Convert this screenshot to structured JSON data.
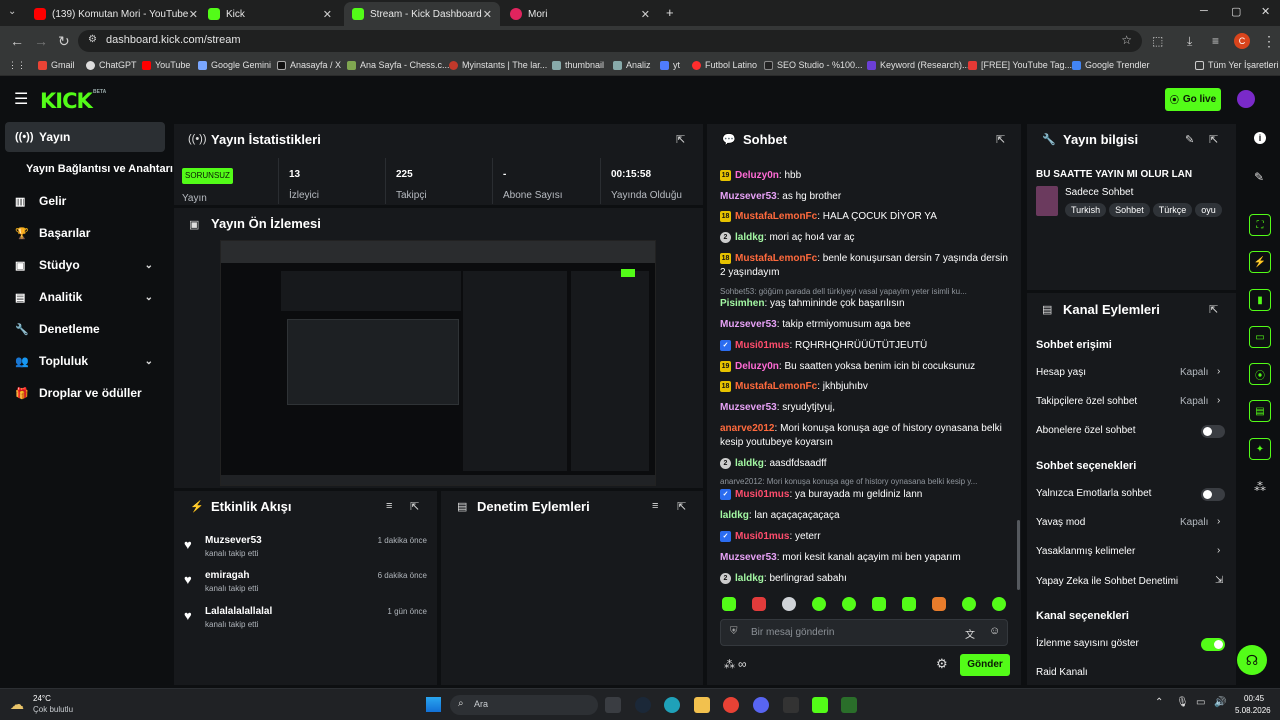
{
  "browser": {
    "tabs": [
      {
        "label": "(139) Komutan Mori - YouTube",
        "color": "#ff0000"
      },
      {
        "label": "Kick",
        "color": "#53fc18"
      },
      {
        "label": "Stream - Kick Dashboard",
        "color": "#53fc18"
      },
      {
        "label": "Mori",
        "color": "#e0245e"
      }
    ],
    "url": "dashboard.kick.com/stream",
    "profile_initial": "C",
    "bookmarks": [
      "Gmail",
      "ChatGPT",
      "YouTube",
      "Google Gemini",
      "Anasayfa / X",
      "Ana Sayfa - Chess.c...",
      "Myinstants | The lar...",
      "thumbnail",
      "Analiz",
      "yt",
      "Futbol Latino",
      "SEO Studio - %100...",
      "Keyword (Research)...",
      "[FREE] YouTube Tag...",
      "Google Trendler",
      "Tüm Yer İşaretleri"
    ]
  },
  "header": {
    "logo": "KICK",
    "logo_badge": "BETA",
    "go_live": "Go live"
  },
  "sidebar": {
    "items": [
      {
        "label": "Yayın",
        "icon": "broadcast-icon"
      },
      {
        "label": "Yayın Bağlantısı ve Anahtarı",
        "icon": ""
      },
      {
        "label": "Gelir",
        "icon": "chart-icon"
      },
      {
        "label": "Başarılar",
        "icon": "trophy-icon"
      },
      {
        "label": "Stüdyo",
        "icon": "studio-icon"
      },
      {
        "label": "Analitik",
        "icon": "analytics-icon"
      },
      {
        "label": "Denetleme",
        "icon": "wrench-icon"
      },
      {
        "label": "Topluluk",
        "icon": "community-icon"
      },
      {
        "label": "Droplar ve ödüller",
        "icon": "gift-icon"
      }
    ]
  },
  "stats": {
    "title": "Yayın İstatistikleri",
    "status_badge": "SORUNSUZ",
    "status_label": "Yayın",
    "items": [
      {
        "value": "13",
        "label": "İzleyici"
      },
      {
        "value": "225",
        "label": "Takipçi"
      },
      {
        "value": "-",
        "label": "Abone Sayısı"
      },
      {
        "value": "00:15:58",
        "label": "Yayında Olduğu"
      }
    ]
  },
  "preview": {
    "title": "Yayın Ön İzlemesi"
  },
  "activity": {
    "title": "Etkinlik Akışı",
    "events": [
      {
        "user": "Muzsever53",
        "action": "kanalı takip etti",
        "time": "1 dakika önce"
      },
      {
        "user": "emiragah",
        "action": "kanalı takip etti",
        "time": "6 dakika önce"
      },
      {
        "user": "Lalalalalallalal",
        "action": "kanalı takip etti",
        "time": "1 gün önce"
      }
    ]
  },
  "moderation": {
    "title": "Denetim Eylemleri"
  },
  "chat": {
    "title": "Sohbet",
    "messages": [
      {
        "user": "Deluzy0n",
        "text": "hbb",
        "color": "u-pink",
        "badge": "19",
        "badge_type": "b-sub"
      },
      {
        "user": "Muzsever53",
        "text": "as hg brother",
        "color": "u-purple",
        "badge": "",
        "badge_type": ""
      },
      {
        "user": "MustafaLemonFc",
        "text": "HALA ÇOCUK DİYOR YA",
        "color": "u-orange",
        "badge": "18",
        "badge_type": "b-sub"
      },
      {
        "user": "laldkg",
        "text": "mori aç hoı4 var aç",
        "color": "u-green",
        "badge": "2",
        "badge_type": "b-n"
      },
      {
        "user": "MustafaLemonFc",
        "text": "benle konuşursan dersin 7 yaşında dersin 2 yaşındayım",
        "color": "u-orange",
        "badge": "18",
        "badge_type": "b-sub"
      },
      {
        "user": "Pisimhen",
        "text": "yaş tahmininde çok başarılısın",
        "color": "u-green",
        "badge": "",
        "badge_type": "",
        "reply": "Sohbet53: göğüm parada dell türkiyeyi vasal yapayim yeter isimli ku..."
      },
      {
        "user": "Muzsever53",
        "text": "takip etrmiyomusum aga bee",
        "color": "u-purple",
        "badge": "",
        "badge_type": ""
      },
      {
        "user": "Musi01mus",
        "text": "RQHRHQHRÜÜÜTÜTJEUTÜ",
        "color": "u-blue",
        "badge": "",
        "badge_type": "b-v"
      },
      {
        "user": "Deluzy0n",
        "text": "Bu saatten yoksa benim icin bi cocuksunuz",
        "color": "u-pink",
        "badge": "19",
        "badge_type": "b-sub"
      },
      {
        "user": "MustafaLemonFc",
        "text": "jkhbjuhıbv",
        "color": "u-orange",
        "badge": "18",
        "badge_type": "b-sub"
      },
      {
        "user": "Muzsever53",
        "text": "sryudytjtyuj,",
        "color": "u-purple",
        "badge": "",
        "badge_type": ""
      },
      {
        "user": "anarve2012",
        "text": "Mori konuşa konuşa age of history oynasana belki kesip youtubeye koyarsın",
        "color": "u-orange",
        "badge": "",
        "badge_type": ""
      },
      {
        "user": "laldkg",
        "text": "aasdfdsaadff",
        "color": "u-green",
        "badge": "2",
        "badge_type": "b-n"
      },
      {
        "user": "Musi01mus",
        "text": "ya burayada mı geldiniz lann",
        "color": "u-blue",
        "badge": "",
        "badge_type": "b-v",
        "reply": "anarve2012: Mori konuşa konuşa age of history oynasana belki kesip y..."
      },
      {
        "user": "laldkg",
        "text": "lan açaçaçaçaçaça",
        "color": "u-green",
        "badge": "",
        "badge_type": ""
      },
      {
        "user": "Musi01mus",
        "text": "yeterr",
        "color": "u-blue",
        "badge": "",
        "badge_type": "b-v"
      },
      {
        "user": "Muzsever53",
        "text": "mori kesit kanalı açayim mi ben yaparım",
        "color": "u-purple",
        "badge": "",
        "badge_type": ""
      },
      {
        "user": "laldkg",
        "text": "berlingrad sabahı",
        "color": "u-green",
        "badge": "2",
        "badge_type": "b-n"
      }
    ],
    "input_placeholder": "Bir mesaj gönderin",
    "send": "Gönder"
  },
  "stream_info": {
    "title": "Yayın bilgisi",
    "stream_title": "BU SAATTE YAYIN MI OLUR LAN",
    "category": "Sadece Sohbet",
    "tags": [
      "Turkish",
      "Sohbet",
      "Türkçe",
      "oyu"
    ]
  },
  "channel_actions": {
    "title": "Kanal Eylemleri",
    "chat_access": "Sohbet erişimi",
    "rows1": [
      {
        "label": "Hesap yaşı",
        "value": "Kapalı",
        "kind": "chevron"
      },
      {
        "label": "Takipçilere özel sohbet",
        "value": "Kapalı",
        "kind": "chevron"
      },
      {
        "label": "Abonelere özel sohbet",
        "value": "",
        "kind": "toggle-off"
      }
    ],
    "chat_options": "Sohbet seçenekleri",
    "rows2": [
      {
        "label": "Yalnızca Emotlarla sohbet",
        "value": "",
        "kind": "toggle-off"
      },
      {
        "label": "Yavaş mod",
        "value": "Kapalı",
        "kind": "chevron"
      },
      {
        "label": "Yasaklanmış kelimeler",
        "value": "",
        "kind": "chevron"
      },
      {
        "label": "Yapay Zeka ile Sohbet Denetimi",
        "value": "",
        "kind": "external"
      }
    ],
    "channel_options": "Kanal seçenekleri",
    "rows3": [
      {
        "label": "İzlenme sayısını göster",
        "value": "",
        "kind": "toggle-on"
      },
      {
        "label": "Raid Kanalı",
        "value": "",
        "kind": "none"
      }
    ]
  },
  "taskbar": {
    "weather_temp": "24°C",
    "weather_desc": "Çok bulutlu",
    "search": "Ara",
    "time": "00:45",
    "date": "5.08.2026"
  }
}
